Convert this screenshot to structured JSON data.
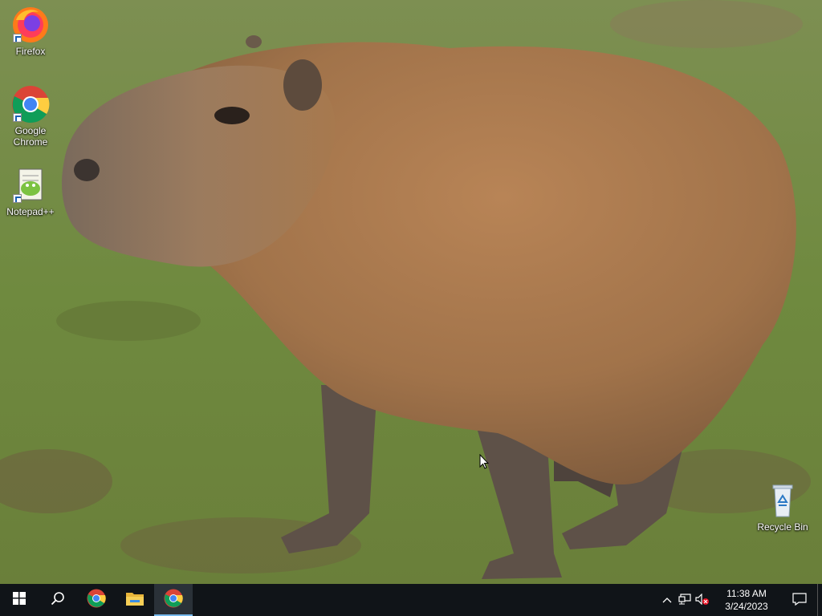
{
  "desktop": {
    "icons": [
      {
        "label": "Firefox",
        "icon": "firefox-icon"
      },
      {
        "label": "Google Chrome",
        "icon": "chrome-icon"
      },
      {
        "label": "Notepad++",
        "icon": "notepadpp-icon"
      },
      {
        "label": "Recycle Bin",
        "icon": "recycle-bin-icon"
      }
    ],
    "wallpaper": "capybara standing on grass"
  },
  "taskbar": {
    "items": [
      {
        "name": "start",
        "icon": "windows-icon"
      },
      {
        "name": "search",
        "icon": "search-icon"
      },
      {
        "name": "chrome-pinned",
        "icon": "chrome-icon"
      },
      {
        "name": "file-explorer",
        "icon": "folder-icon"
      },
      {
        "name": "chrome-running",
        "icon": "chrome-icon",
        "active": true
      }
    ],
    "tray": {
      "icons": [
        "chevron-up-icon",
        "network-icon",
        "volume-muted-icon"
      ],
      "time": "11:38 AM",
      "date": "3/24/2023",
      "notification_icon": "action-center-icon"
    }
  },
  "colors": {
    "taskbar": "#101418",
    "accent": "#76b9ed"
  }
}
